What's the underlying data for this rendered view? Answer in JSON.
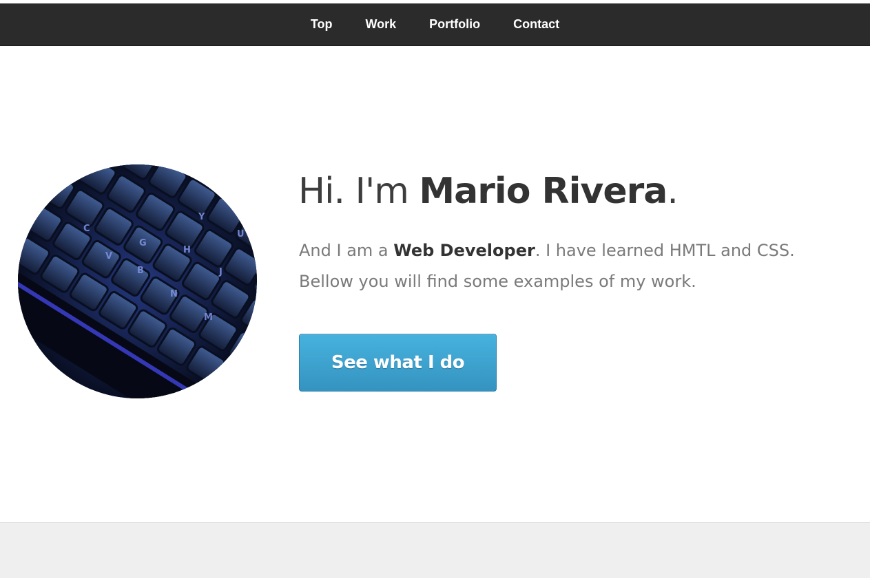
{
  "nav": {
    "items": [
      {
        "label": "Top"
      },
      {
        "label": "Work"
      },
      {
        "label": "Portfolio"
      },
      {
        "label": "Contact"
      }
    ]
  },
  "hero": {
    "greeting_prefix": "Hi. I'm ",
    "name": "Mario Rivera",
    "greeting_suffix": ".",
    "intro_prefix": "And I am a ",
    "role": "Web Developer",
    "intro_suffix": ". I have learned HMTL and CSS. Bellow you will find some examples of my work.",
    "cta_label": "See what I do",
    "image": "keyboard-photo"
  },
  "colors": {
    "navbar_bg": "#2b2b2b",
    "cta_blue": "#3da4d1",
    "heading_text": "#333333",
    "body_text": "#7a7a7a",
    "footer_bg": "#efefef"
  }
}
